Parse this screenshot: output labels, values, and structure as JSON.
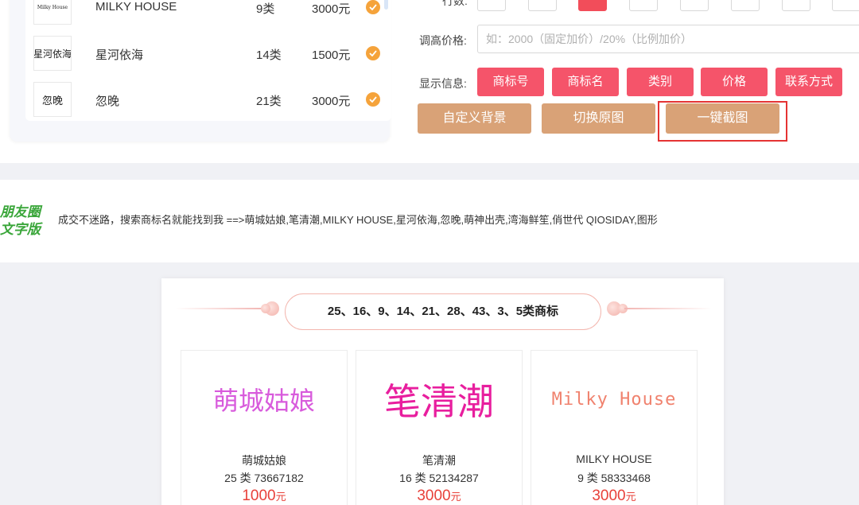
{
  "list": {
    "rows": [
      {
        "logo_text": "Milky House",
        "name": "MILKY HOUSE",
        "class": "9类",
        "price": "3000元"
      },
      {
        "logo_text": "星河依海",
        "name": "星河依海",
        "class": "14类",
        "price": "1500元"
      },
      {
        "logo_text": "忽晚",
        "name": "忽晚",
        "class": "21类",
        "price": "3000元"
      }
    ]
  },
  "controls": {
    "rows_label": "行数:",
    "price_label": "调高价格:",
    "price_placeholder": "如：2000（固定加价）/20%（比例加价）",
    "display_label": "显示信息:",
    "display_buttons": [
      "商标号",
      "商标名",
      "类别",
      "价格",
      "联系方式"
    ],
    "action_buttons": [
      "自定义背景",
      "切换原图",
      "一键截图"
    ]
  },
  "moments": {
    "title_line1": "朋友圈",
    "title_line2": "文字版",
    "text": "成交不迷路，搜索商标名就能找到我 ==>萌城姑娘,笔清潮,MILKY HOUSE,星河依海,忽晚,萌神出壳,湾海鲜笙,俏世代 QIOSIDAY,图形"
  },
  "poster": {
    "header": "25、16、9、14、21、28、43、3、5类商标",
    "cards": [
      {
        "logo_text": "萌城姑娘",
        "name": "萌城姑娘",
        "meta": "25 类  73667182",
        "price": "1000",
        "unit": "元"
      },
      {
        "logo_text": "笔清潮",
        "name": "笔清潮",
        "meta": "16 类  52134287",
        "price": "3000",
        "unit": "元"
      },
      {
        "logo_text": "Milky House",
        "name": "MILKY HOUSE",
        "meta": "9 类  58333468",
        "price": "3000",
        "unit": "元"
      }
    ]
  },
  "colors": {
    "accent_pink": "#f5546a",
    "accent_tan": "#d9a277",
    "highlight_red": "#e53333",
    "price_red": "#e8413a",
    "moments_green": "#3aa63a"
  }
}
